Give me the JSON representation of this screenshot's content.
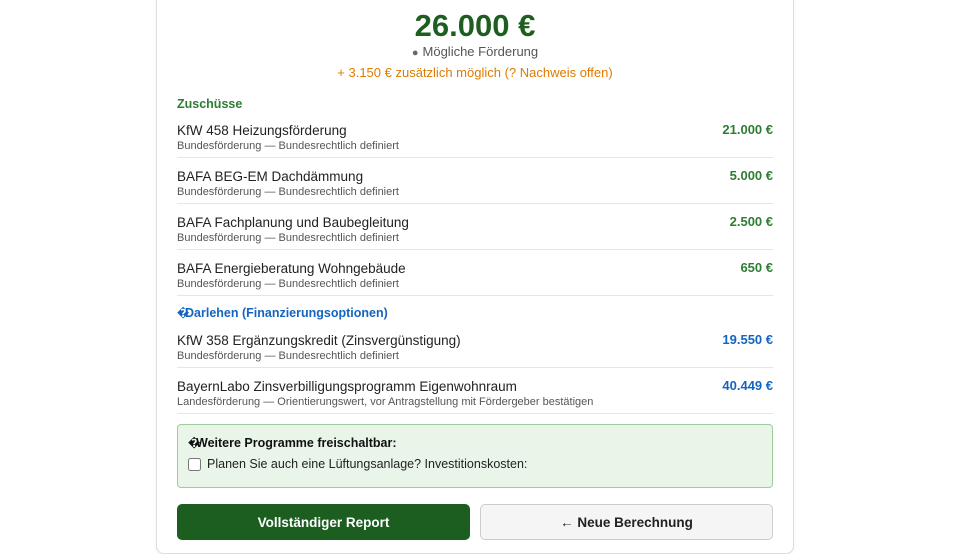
{
  "summary": {
    "total": "26.000 €",
    "label": "Mögliche Förderung",
    "extra": "+ 3.150 € zusätzlich möglich (? Nachweis offen)"
  },
  "grants": {
    "title": "Zuschüsse",
    "items": [
      {
        "name": "KfW 458 Heizungsförderung",
        "desc": "Bundesförderung — Bundesrechtlich definiert",
        "amount": "21.000 €"
      },
      {
        "name": "BAFA BEG-EM Dachdämmung",
        "desc": "Bundesförderung — Bundesrechtlich definiert",
        "amount": "5.000 €"
      },
      {
        "name": "BAFA Fachplanung und Baubegleitung",
        "desc": "Bundesförderung — Bundesrechtlich definiert",
        "amount": "2.500 €"
      },
      {
        "name": "BAFA Energieberatung Wohngebäude",
        "desc": "Bundesförderung — Bundesrechtlich definiert",
        "amount": "650 €"
      }
    ]
  },
  "loans": {
    "title": "Darlehen (Finanzierungsoptionen)",
    "items": [
      {
        "name": "KfW 358 Ergänzungskredit (Zinsvergünstigung)",
        "desc": "Bundesförderung — Bundesrechtlich definiert",
        "amount": "19.550 €"
      },
      {
        "name": "BayernLabo Zinsverbilligungsprogramm Eigenwohnraum",
        "desc": "Landesförderung — Orientierungswert, vor Antragstellung mit Fördergeber bestätigen",
        "amount": "40.449 €"
      }
    ]
  },
  "unlock": {
    "title": "Weitere Programme freischaltbar:",
    "option": "Planen Sie auch eine Lüftungsanlage? Investitionskosten:"
  },
  "buttons": {
    "report": "Vollständiger Report",
    "new": "← Neue Berechnung"
  },
  "colors": {
    "primary_green": "#1b5e20",
    "grant_green": "#2e7d32",
    "loan_blue": "#1565c0",
    "warning_orange": "#e07b00"
  },
  "icons": {
    "loans_section": "missing-glyph-icon",
    "unlock_section": "missing-glyph-icon"
  }
}
